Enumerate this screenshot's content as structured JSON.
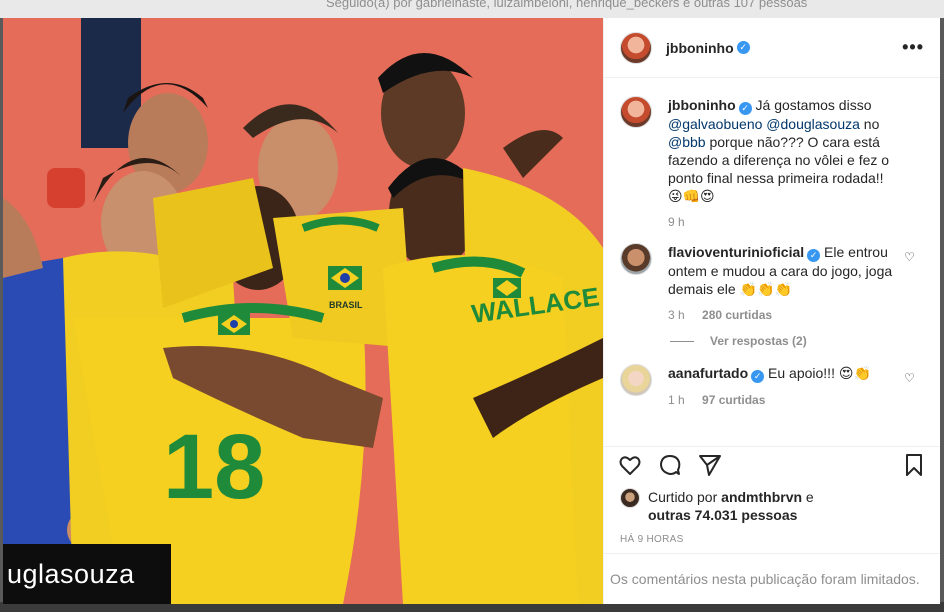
{
  "background": {
    "followed_by": "Seguido(a) por gabrielnaste, luizalmbeloni, henrique_beckers e outras 107 pessoas"
  },
  "photo": {
    "overlay_tag": "uglasouza",
    "jersey_country": "BRASIL",
    "jersey_number": "18",
    "jersey_name": "WALLACE"
  },
  "header": {
    "username": "jbboninho",
    "more_label": "•••"
  },
  "caption": {
    "username": "jbboninho",
    "text_1": " Já gostamos disso ",
    "mention_1": "@galvaobueno",
    "space_1": " ",
    "mention_2": "@douglasouza",
    "text_2": " no ",
    "mention_3": "@bbb",
    "text_3": " porque não??? O cara está fazendo a diferença no vôlei e fez o ponto final nessa primeira rodada!! ",
    "emojis": "😜👊😍",
    "time": "9 h"
  },
  "comments": [
    {
      "username": "flavioventurinioficial",
      "text": " Ele entrou ontem e mudou a cara do jogo, joga demais ele ",
      "emojis": "👏👏👏",
      "time": "3 h",
      "likes": "280 curtidas",
      "replies": "Ver respostas (2)"
    },
    {
      "username": "aanafurtado",
      "text": " Eu apoio!!! ",
      "emojis": "😍👏",
      "time": "1 h",
      "likes": "97 curtidas"
    }
  ],
  "likes": {
    "prefix": "Curtido por ",
    "user": "andmthbrvn",
    "middle": " e",
    "others": "outras 74.031 pessoas"
  },
  "post_time": "HÁ 9 HORAS",
  "comments_limited": "Os comentários nesta publicação foram limitados.",
  "colors": {
    "verified": "#3897f0",
    "mention": "#00376b",
    "jersey": "#f5d020",
    "jersey_trim": "#1f8a3a",
    "court": "#e8715e"
  }
}
